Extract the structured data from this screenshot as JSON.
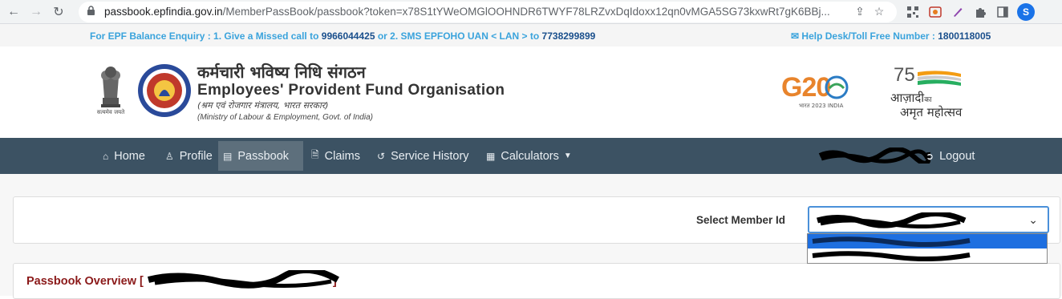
{
  "browser": {
    "url_domain": "passbook.epfindia.gov.in",
    "url_path": "/MemberPassBook/passbook?token=x78S1tYWeOMGlOOHNDR6TWYF78LRZvxDqIdoxx12qn0vMGA5SG73kxwRt7gK6BBj...",
    "profile_initial": "S"
  },
  "infobar": {
    "enquiry_prefix": "For EPF Balance Enquiry : ",
    "enquiry_text_1": "1. Give a Missed call to ",
    "missed_call_number": "9966044425",
    "enquiry_text_2": " or 2. SMS EPFOHO UAN < LAN > to ",
    "sms_number": "7738299899",
    "helpdesk_label": "Help Desk/Toll Free Number : ",
    "helpdesk_number": "1800118005"
  },
  "header": {
    "org_hindi": "कर्मचारी भविष्य निधि संगठन",
    "org_english": "Employees' Provident Fund Organisation",
    "ministry_hindi": "(श्रम एवं रोजगार मंत्रालय, भारत सरकार)",
    "ministry_english": "(Ministry of Labour & Employment, Govt. of India)",
    "emblem_caption": "सत्यमेव जयते",
    "g20_text": "G20",
    "g20_sub": "भारत 2023 INDIA",
    "azadi_75": "75",
    "azadi_line1": "आज़ादी",
    "azadi_ka": "का",
    "azadi_line2": "अमृत महोत्सव"
  },
  "nav": {
    "items": [
      {
        "label": "Home",
        "icon": "home-icon"
      },
      {
        "label": "Profile",
        "icon": "user-icon"
      },
      {
        "label": "Passbook",
        "icon": "passbook-icon"
      },
      {
        "label": "Claims",
        "icon": "document-icon"
      },
      {
        "label": "Service History",
        "icon": "history-icon"
      },
      {
        "label": "Calculators",
        "icon": "calculator-icon"
      }
    ],
    "logout": "Logout"
  },
  "member": {
    "label": "Select Member Id"
  },
  "overview": {
    "title": "Passbook Overview",
    "bracket_open": "[",
    "bracket_close": "]"
  },
  "colors": {
    "navbar": "#3c5263",
    "accent_blue": "#3aa3dc",
    "overview_title": "#8b1a1a",
    "select_border": "#4a90d9"
  }
}
